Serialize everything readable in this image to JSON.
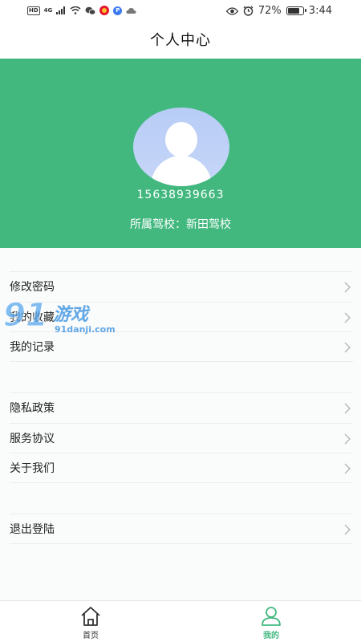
{
  "status_bar": {
    "hd": "HD",
    "network": "4G",
    "battery_percent": "72%",
    "battery_level": 0.72,
    "time": "3:44",
    "blue_app_letter": "P"
  },
  "header": {
    "title": "个人中心"
  },
  "profile": {
    "phone": "15638939663",
    "school": "所属驾校：新田驾校"
  },
  "menu": {
    "group1": [
      {
        "label": "修改密码"
      },
      {
        "label": "我的收藏"
      },
      {
        "label": "我的记录"
      }
    ],
    "group2": [
      {
        "label": "隐私政策"
      },
      {
        "label": "服务协议"
      },
      {
        "label": "关于我们"
      }
    ],
    "group3": [
      {
        "label": "退出登陆"
      }
    ]
  },
  "watermark": {
    "number": "91",
    "text": "游戏",
    "domain": "91danji.com"
  },
  "tabbar": {
    "home_label": "首页",
    "mine_label": "我的"
  },
  "colors": {
    "brand_green": "#42b87f",
    "avatar_blue": "#b7ccf6"
  }
}
